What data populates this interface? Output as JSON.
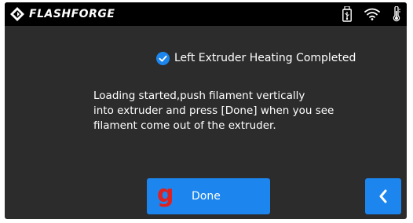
{
  "header": {
    "brand": "FLASHFORGE",
    "logo_icon": "flashforge-logo-icon",
    "status_icons": [
      "usb-drive-icon",
      "wifi-icon",
      "thermometer-icon"
    ]
  },
  "dialog": {
    "status_icon": "check-circle-icon",
    "status_text": "Left Extruder Heating Completed",
    "instructions": [
      "Loading started,push filament vertically",
      "into extruder and press [Done] when you see",
      "filament come out of the extruder."
    ]
  },
  "actions": {
    "done_glyph": "g",
    "done_label": "Done",
    "back_icon": "chevron-left-icon"
  },
  "colors": {
    "background": "#2c2c2c",
    "topbar": "#000000",
    "accent": "#1c86ee",
    "glyph": "#e0201e",
    "text": "#ffffff"
  }
}
